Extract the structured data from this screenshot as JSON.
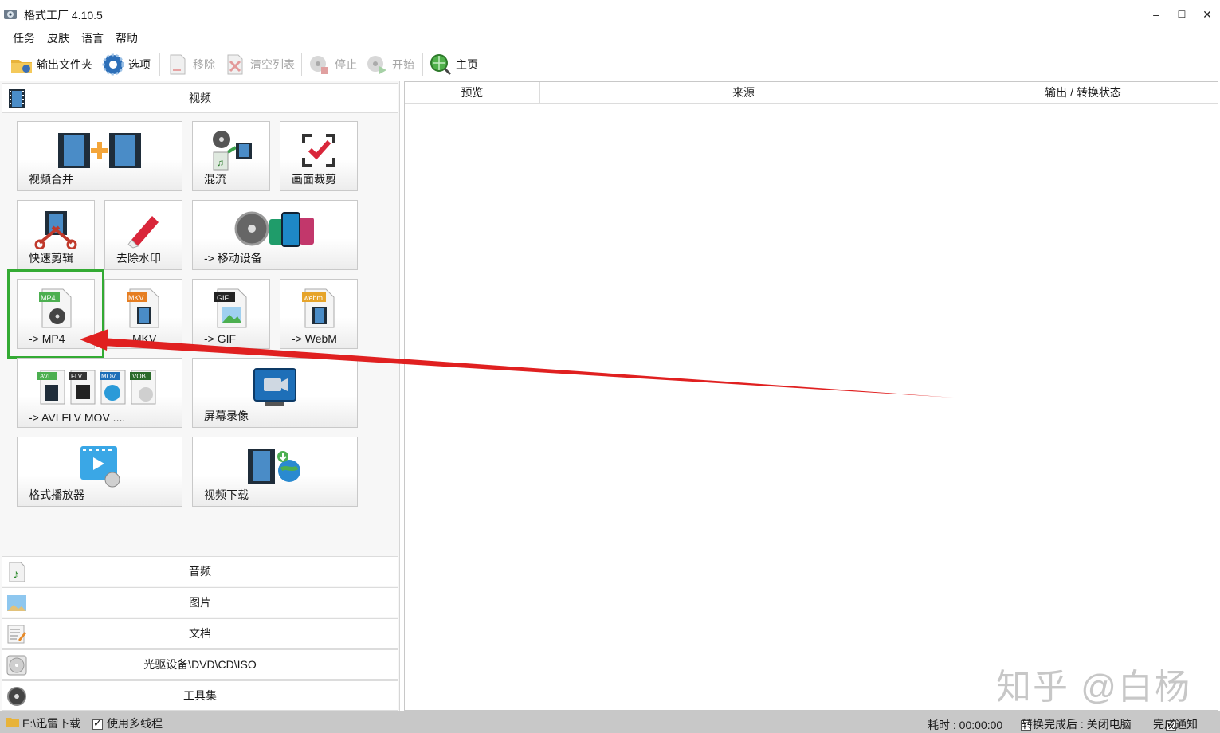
{
  "window": {
    "title": "格式工厂 4.10.5",
    "min": "–",
    "max": "☐",
    "close": "✕"
  },
  "menu": [
    "任务",
    "皮肤",
    "语言",
    "帮助"
  ],
  "toolbar": {
    "output_folder": "输出文件夹",
    "options": "选项",
    "remove": "移除",
    "clear_list": "清空列表",
    "stop": "停止",
    "start": "开始",
    "home": "主页"
  },
  "categories": {
    "video": "视频",
    "audio": "音频",
    "image": "图片",
    "document": "文档",
    "disc": "光驱设备\\DVD\\CD\\ISO",
    "tools": "工具集"
  },
  "tiles": {
    "merge": "视频合并",
    "mux": "混流",
    "crop": "画面裁剪",
    "quick_cut": "快速剪辑",
    "remove_watermark": "去除水印",
    "mobile": "-> 移动设备",
    "mp4": "-> MP4",
    "mkv": "MKV",
    "gif": "-> GIF",
    "webm": "-> WebM",
    "avi_flv_mov": "-> AVI FLV MOV ....",
    "screen_record": "屏幕录像",
    "player": "格式播放器",
    "download": "视频下载"
  },
  "icon_badges": {
    "mp4": "MP4",
    "mkv": "MKV",
    "gif": "GIF",
    "webm": "webm",
    "avi": "AVI",
    "flv": "FLV",
    "mov": "MOV",
    "vob": "VOB"
  },
  "list_columns": [
    "预览",
    "来源",
    "输出 / 转换状态"
  ],
  "status": {
    "folder": "E:\\迅雷下载",
    "multithread": "使用多线程",
    "elapsed": "耗时 : 00:00:00",
    "after_done": "转换完成后 : 关闭电脑",
    "notify": "完成通知"
  },
  "watermark": "知乎 @白杨",
  "colors": {
    "highlight": "#33aa33",
    "arrow": "#e02020",
    "statusbar": "#c8c8c8"
  }
}
